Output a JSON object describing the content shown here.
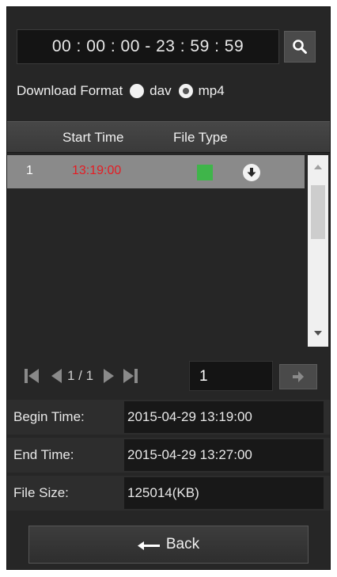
{
  "search": {
    "time_range": "00 : 00 : 00 - 23 : 59 : 59",
    "search_icon": "search-icon"
  },
  "download_format": {
    "label": "Download Format",
    "options": [
      {
        "label": "dav",
        "selected": false
      },
      {
        "label": "mp4",
        "selected": true
      }
    ]
  },
  "table": {
    "columns": [
      "Start Time",
      "File Type"
    ],
    "rows": [
      {
        "index": "1",
        "start_time": "13:19:00",
        "file_type_color": "#3fb54a",
        "download_icon": "download-icon"
      }
    ]
  },
  "pager": {
    "page_label": "1 / 1",
    "page_input": "1",
    "icons": [
      "first-page-icon",
      "prev-page-icon",
      "next-page-icon",
      "last-page-icon",
      "go-arrow-icon"
    ]
  },
  "info": {
    "begin_time_label": "Begin Time:",
    "begin_time_value": "2015-04-29 13:19:00",
    "end_time_label": "End Time:",
    "end_time_value": "2015-04-29 13:27:00",
    "file_size_label": "File Size:",
    "file_size_value": "125014(KB)"
  },
  "back_button": {
    "label": "Back",
    "icon": "back-arrow-icon"
  },
  "colors": {
    "panel_bg": "#262626",
    "selected_row": "#8a8a8a",
    "start_time_text": "#e51c23",
    "file_type_square": "#3fb54a"
  }
}
